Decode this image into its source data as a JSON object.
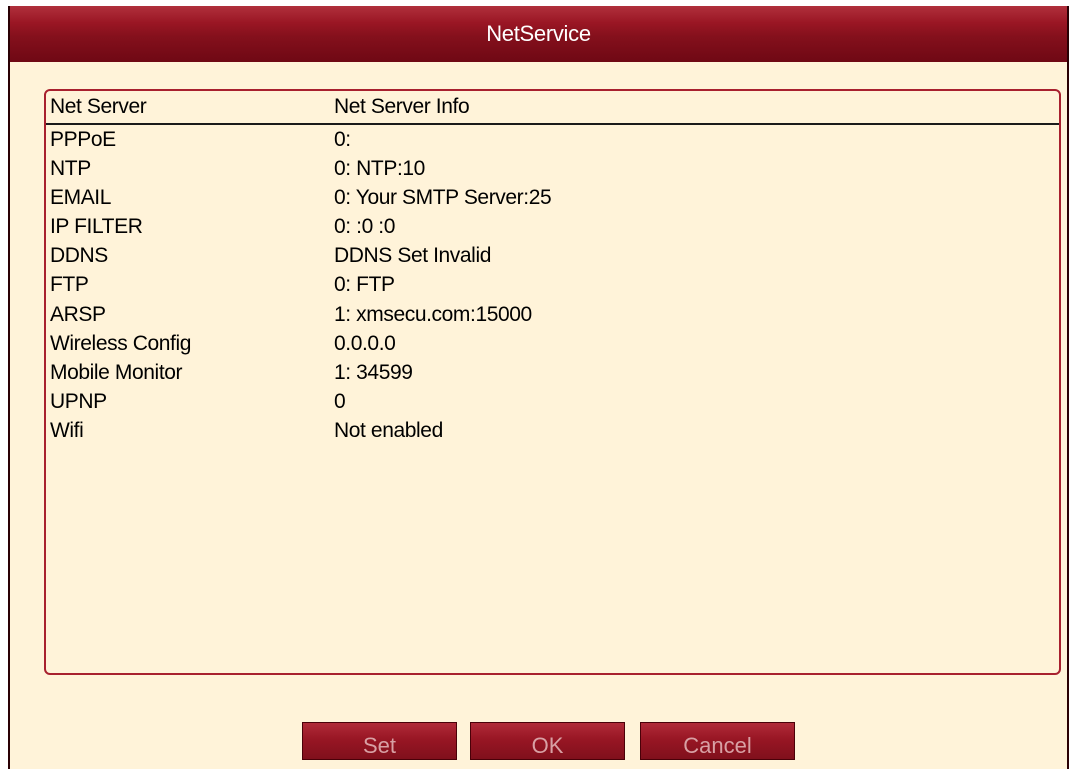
{
  "window": {
    "title": "NetService"
  },
  "table": {
    "headers": {
      "server": "Net Server",
      "info": "Net Server Info"
    },
    "rows": [
      {
        "server": "PPPoE",
        "info": "0:"
      },
      {
        "server": "NTP",
        "info": "0: NTP:10"
      },
      {
        "server": "EMAIL",
        "info": "0: Your SMTP Server:25"
      },
      {
        "server": "IP FILTER",
        "info": "0: :0 :0"
      },
      {
        "server": "DDNS",
        "info": "DDNS Set Invalid"
      },
      {
        "server": "FTP",
        "info": "0: FTP"
      },
      {
        "server": "ARSP",
        "info": "1: xmsecu.com:15000"
      },
      {
        "server": "Wireless Config",
        "info": "0.0.0.0"
      },
      {
        "server": "Mobile Monitor",
        "info": "1: 34599"
      },
      {
        "server": "UPNP",
        "info": "0"
      },
      {
        "server": "Wifi",
        "info": "Not enabled"
      }
    ]
  },
  "buttons": {
    "set_label": "Set",
    "ok_label": "OK",
    "cancel_label": "Cancel"
  },
  "colors": {
    "titlebar": "#84101c",
    "background": "#fff3d9",
    "panel_border": "#a8202e",
    "button_text": "#d8a0a4"
  }
}
